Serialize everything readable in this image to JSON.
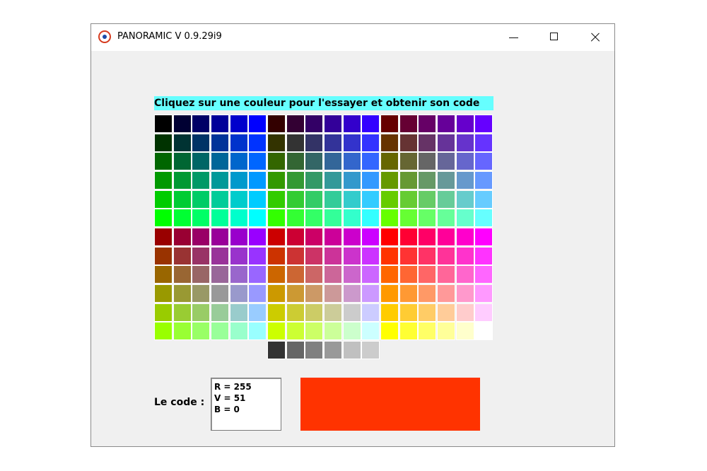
{
  "window": {
    "title": "PANORAMIC V 0.9.29i9",
    "controls": {
      "minimize": "minimize-icon",
      "maximize": "maximize-icon",
      "close": "close-icon"
    }
  },
  "instruction": "Cliquez sur une couleur pour l'essayer et obtenir son code",
  "palette": {
    "levels": [
      "00",
      "33",
      "66",
      "99",
      "CC",
      "FF"
    ],
    "grays": [
      "#333333",
      "#666666",
      "#808080",
      "#999999",
      "#c0c0c0",
      "#cccccc"
    ]
  },
  "code": {
    "label": "Le code :",
    "lines": [
      "R = 255",
      "V = 51",
      "B = 0"
    ]
  },
  "preview": {
    "color": "#ff3300"
  }
}
